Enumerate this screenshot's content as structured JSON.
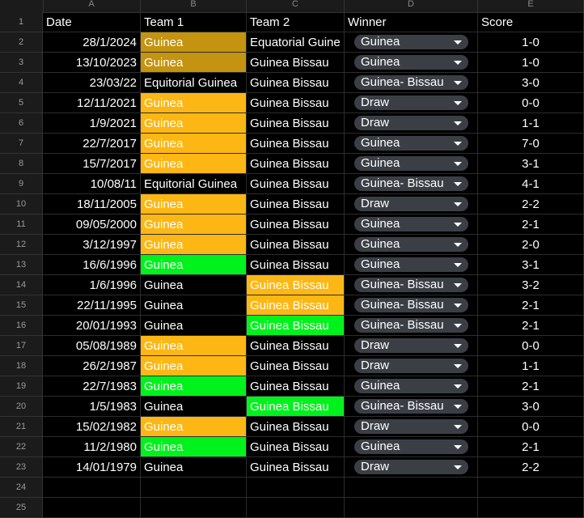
{
  "columns": [
    "A",
    "B",
    "C",
    "D",
    "E"
  ],
  "header": {
    "row_number": "1",
    "date": "Date",
    "team1": "Team 1",
    "team2": "Team 2",
    "winner": "Winner",
    "score": "Score"
  },
  "colors": {
    "gold": "#c4930f",
    "orange": "#fdb714",
    "green": "#00f21c",
    "chip": "#3b3f45"
  },
  "rows": [
    {
      "n": "2",
      "date": "28/1/2024",
      "team1": "Guinea",
      "team2": "Equatorial Guine",
      "winner": "Guinea",
      "score": "1-0",
      "h1": "gold",
      "h2": ""
    },
    {
      "n": "3",
      "date": "13/10/2023",
      "team1": "Guinea",
      "team2": "Guinea Bissau",
      "winner": "Guinea",
      "score": "1-0",
      "h1": "gold",
      "h2": ""
    },
    {
      "n": "4",
      "date": "23/03/22",
      "team1": "Equitorial Guinea",
      "team2": "Guinea Bissau",
      "winner": "Guinea- Bissau",
      "score": "3-0",
      "h1": "",
      "h2": ""
    },
    {
      "n": "5",
      "date": "12/11/2021",
      "team1": "Guinea",
      "team2": "Guinea Bissau",
      "winner": "Draw",
      "score": "0-0",
      "h1": "orange",
      "h2": ""
    },
    {
      "n": "6",
      "date": "1/9/2021",
      "team1": "Guinea",
      "team2": "Guinea Bissau",
      "winner": "Draw",
      "score": "1-1",
      "h1": "orange",
      "h2": ""
    },
    {
      "n": "7",
      "date": "22/7/2017",
      "team1": "Guinea",
      "team2": "Guinea Bissau",
      "winner": "Guinea",
      "score": "7-0",
      "h1": "orange",
      "h2": ""
    },
    {
      "n": "8",
      "date": "15/7/2017",
      "team1": "Guinea",
      "team2": "Guinea Bissau",
      "winner": "Guinea",
      "score": "3-1",
      "h1": "orange",
      "h2": ""
    },
    {
      "n": "9",
      "date": "10/08/11",
      "team1": "Equitorial Guinea",
      "team2": "Guinea Bissau",
      "winner": "Guinea- Bissau",
      "score": "4-1",
      "h1": "",
      "h2": ""
    },
    {
      "n": "10",
      "date": "18/11/2005",
      "team1": "Guinea",
      "team2": "Guinea Bissau",
      "winner": "Draw",
      "score": "2-2",
      "h1": "orange",
      "h2": ""
    },
    {
      "n": "11",
      "date": "09/05/2000",
      "team1": "Guinea",
      "team2": "Guinea Bissau",
      "winner": "Guinea",
      "score": "2-1",
      "h1": "orange",
      "h2": ""
    },
    {
      "n": "12",
      "date": "3/12/1997",
      "team1": "Guinea",
      "team2": "Guinea Bissau",
      "winner": "Guinea",
      "score": "2-0",
      "h1": "orange",
      "h2": ""
    },
    {
      "n": "13",
      "date": "16/6/1996",
      "team1": "Guinea",
      "team2": "Guinea Bissau",
      "winner": "Guinea",
      "score": "3-1",
      "h1": "green",
      "h2": ""
    },
    {
      "n": "14",
      "date": "1/6/1996",
      "team1": "Guinea",
      "team2": "Guinea Bissau",
      "winner": "Guinea- Bissau",
      "score": "3-2",
      "h1": "",
      "h2": "orange"
    },
    {
      "n": "15",
      "date": "22/11/1995",
      "team1": "Guinea",
      "team2": "Guinea Bissau",
      "winner": "Guinea- Bissau",
      "score": "2-1",
      "h1": "",
      "h2": "orange"
    },
    {
      "n": "16",
      "date": "20/01/1993",
      "team1": "Guinea",
      "team2": "Guinea Bissau",
      "winner": "Guinea- Bissau",
      "score": "2-1",
      "h1": "",
      "h2": "green"
    },
    {
      "n": "17",
      "date": "05/08/1989",
      "team1": "Guinea",
      "team2": "Guinea Bissau",
      "winner": "Draw",
      "score": "0-0",
      "h1": "orange",
      "h2": ""
    },
    {
      "n": "18",
      "date": "26/2/1987",
      "team1": "Guinea",
      "team2": "Guinea Bissau",
      "winner": "Draw",
      "score": "1-1",
      "h1": "orange",
      "h2": ""
    },
    {
      "n": "19",
      "date": "22/7/1983",
      "team1": "Guinea",
      "team2": "Guinea Bissau",
      "winner": "Guinea",
      "score": "2-1",
      "h1": "green",
      "h2": ""
    },
    {
      "n": "20",
      "date": "1/5/1983",
      "team1": "Guinea",
      "team2": "Guinea Bissau",
      "winner": "Guinea- Bissau",
      "score": "3-0",
      "h1": "",
      "h2": "green"
    },
    {
      "n": "21",
      "date": "15/02/1982",
      "team1": "Guinea",
      "team2": "Guinea Bissau",
      "winner": "Draw",
      "score": "0-0",
      "h1": "orange",
      "h2": ""
    },
    {
      "n": "22",
      "date": "11/2/1980",
      "team1": "Guinea",
      "team2": "Guinea Bissau",
      "winner": "Guinea",
      "score": "2-1",
      "h1": "green",
      "h2": ""
    },
    {
      "n": "23",
      "date": "14/01/1979",
      "team1": "Guinea",
      "team2": "Guinea Bissau",
      "winner": "Draw",
      "score": "2-2",
      "h1": "",
      "h2": ""
    }
  ],
  "empty_rows": [
    "24",
    "25"
  ]
}
